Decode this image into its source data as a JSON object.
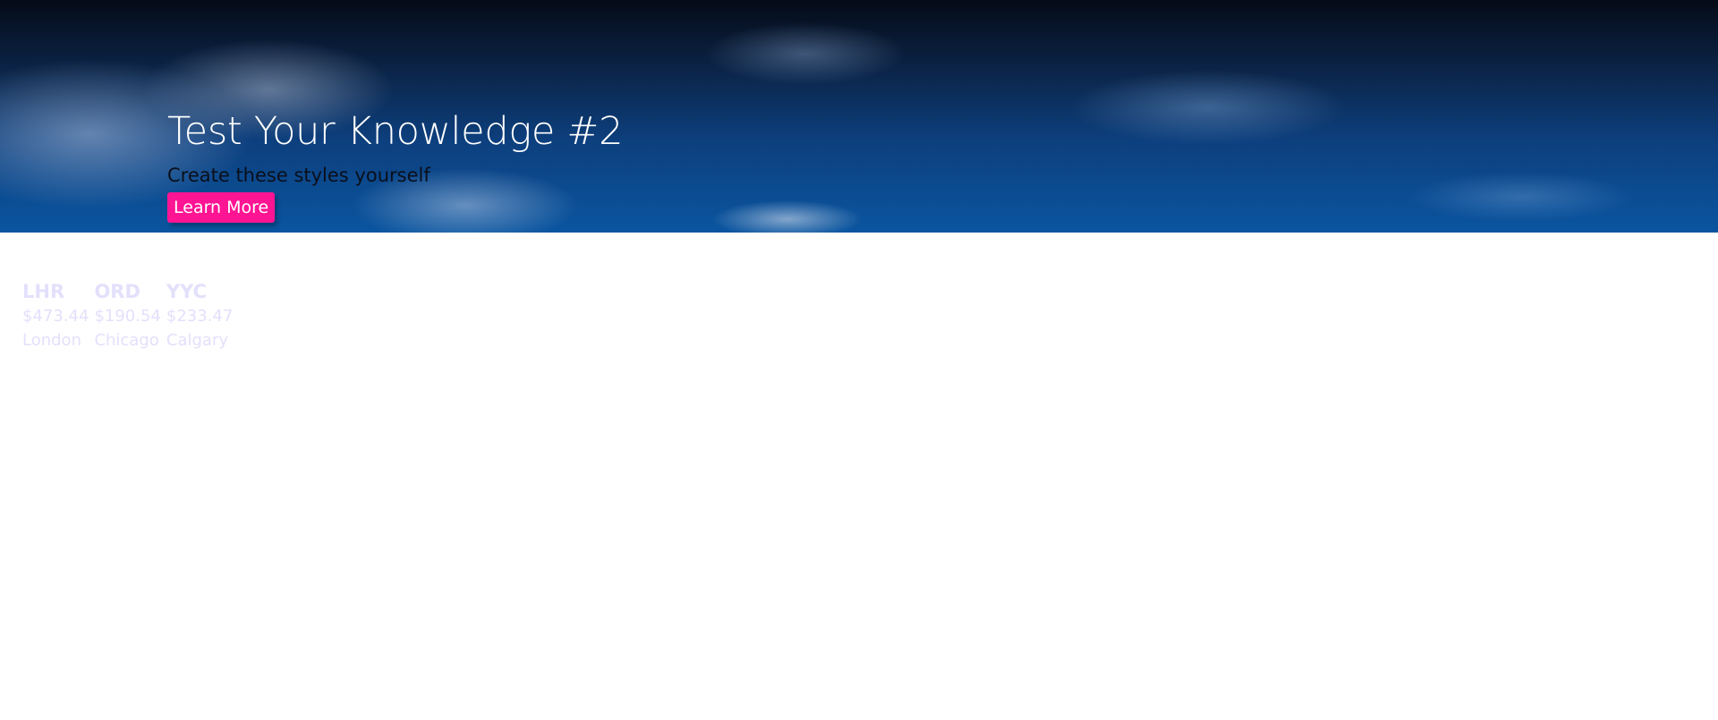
{
  "hero": {
    "title": "Test Your Knowledge #2",
    "subtitle": "Create these styles yourself",
    "button_label": "Learn More",
    "button_color": "#ff1493"
  },
  "airports": [
    {
      "code": "LHR",
      "price": "$473.44",
      "city": "London"
    },
    {
      "code": "ORD",
      "price": "$190.54",
      "city": "Chicago"
    },
    {
      "code": "YYC",
      "price": "$233.47",
      "city": "Calgary"
    }
  ],
  "colors": {
    "airport_text": "#e3e0fb",
    "hero_sky": "#0d3f7d"
  }
}
